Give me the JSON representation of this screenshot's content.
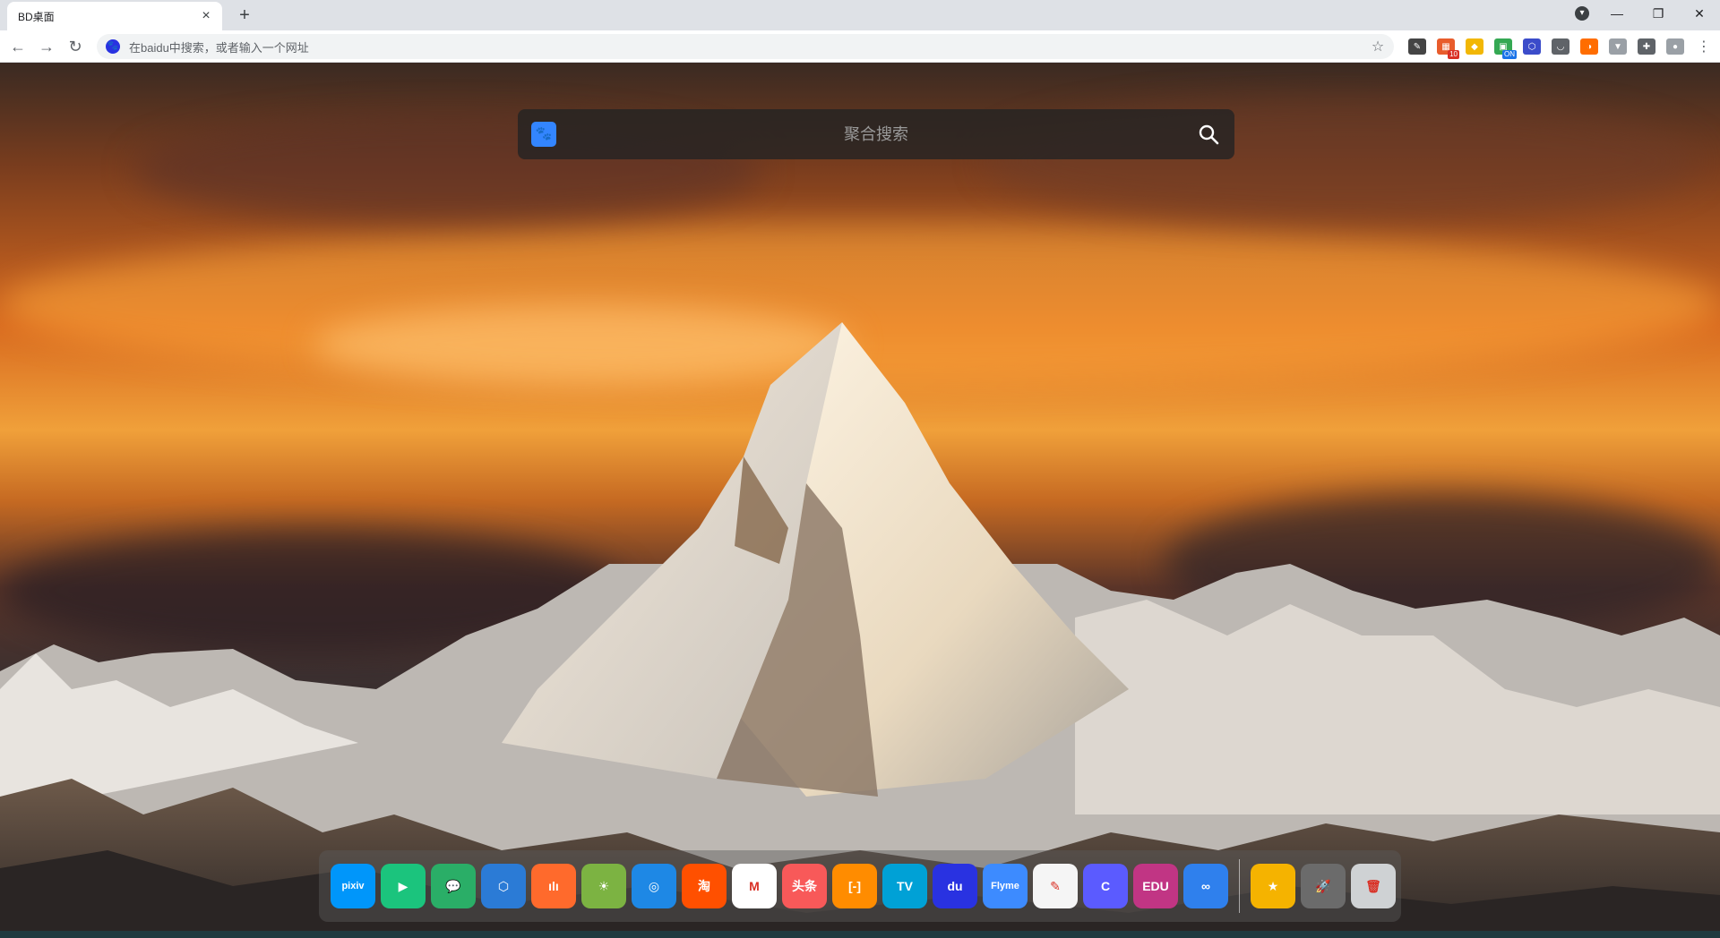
{
  "browser": {
    "tab_title": "BD桌面",
    "tab_close": "×",
    "new_tab": "+",
    "address_placeholder": "在baidu中搜索，或者输入一个网址",
    "extensions": [
      {
        "name": "ext-1",
        "color": "#444444",
        "glyph": "✎"
      },
      {
        "name": "ext-2",
        "color": "#e85c2c",
        "glyph": "▦",
        "badge": "10",
        "badge_color": "#d93025"
      },
      {
        "name": "ext-3",
        "color": "#f2b705",
        "glyph": "◆"
      },
      {
        "name": "ext-4",
        "color": "#34a853",
        "glyph": "▣",
        "badge": "ON",
        "badge_color": "#1a73e8"
      },
      {
        "name": "ext-5",
        "color": "#3b4cca",
        "glyph": "⬡"
      },
      {
        "name": "ext-6",
        "color": "#5f6368",
        "glyph": "◡"
      },
      {
        "name": "ext-7",
        "color": "#ff6d00",
        "glyph": "◑"
      },
      {
        "name": "ext-8",
        "color": "#9aa0a6",
        "glyph": "▼"
      },
      {
        "name": "ext-9",
        "color": "#5f6368",
        "glyph": "✚"
      },
      {
        "name": "profile",
        "color": "#9aa0a6",
        "glyph": "●"
      }
    ]
  },
  "search": {
    "placeholder": "聚合搜索",
    "engine": "baidu"
  },
  "dock": {
    "apps": [
      {
        "name": "pixiv",
        "label": "pixiv",
        "bg": "#0096fa"
      },
      {
        "name": "video-play",
        "label": "▶",
        "bg": "#1bc47d"
      },
      {
        "name": "wechat",
        "label": "💬",
        "bg": "#2aae67"
      },
      {
        "name": "hexagon-app",
        "label": "⬡",
        "bg": "#2b7bd6"
      },
      {
        "name": "podcast",
        "label": "ılı",
        "bg": "#ff6a2c"
      },
      {
        "name": "sunrise-app",
        "label": "☀",
        "bg": "#7cb342"
      },
      {
        "name": "edge-browser",
        "label": "◎",
        "bg": "#1e88e5"
      },
      {
        "name": "taobao",
        "label": "淘",
        "bg": "#ff5000"
      },
      {
        "name": "gmail",
        "label": "M",
        "bg": "#ffffff"
      },
      {
        "name": "toutiao",
        "label": "头条",
        "bg": "#f85959"
      },
      {
        "name": "code-app",
        "label": "[-]",
        "bg": "#ff8c00"
      },
      {
        "name": "bilibili",
        "label": "TV",
        "bg": "#00a1d6"
      },
      {
        "name": "baidu",
        "label": "du",
        "bg": "#2932e1"
      },
      {
        "name": "flyme",
        "label": "Flyme",
        "bg": "#3d8bff"
      },
      {
        "name": "notes",
        "label": "✎",
        "bg": "#f5f5f5"
      },
      {
        "name": "c-app",
        "label": "C",
        "bg": "#5b5bff"
      },
      {
        "name": "edu-app",
        "label": "EDU",
        "bg": "#c13584"
      },
      {
        "name": "infinity-app",
        "label": "∞",
        "bg": "#2f80ed"
      }
    ],
    "utilities": [
      {
        "name": "favorites",
        "label": "★",
        "bg": "#f5b300"
      },
      {
        "name": "launchpad",
        "label": "🚀",
        "bg": "#6b6b6b"
      },
      {
        "name": "trash",
        "label": "🗑",
        "bg": "#cfd2d4"
      }
    ]
  }
}
